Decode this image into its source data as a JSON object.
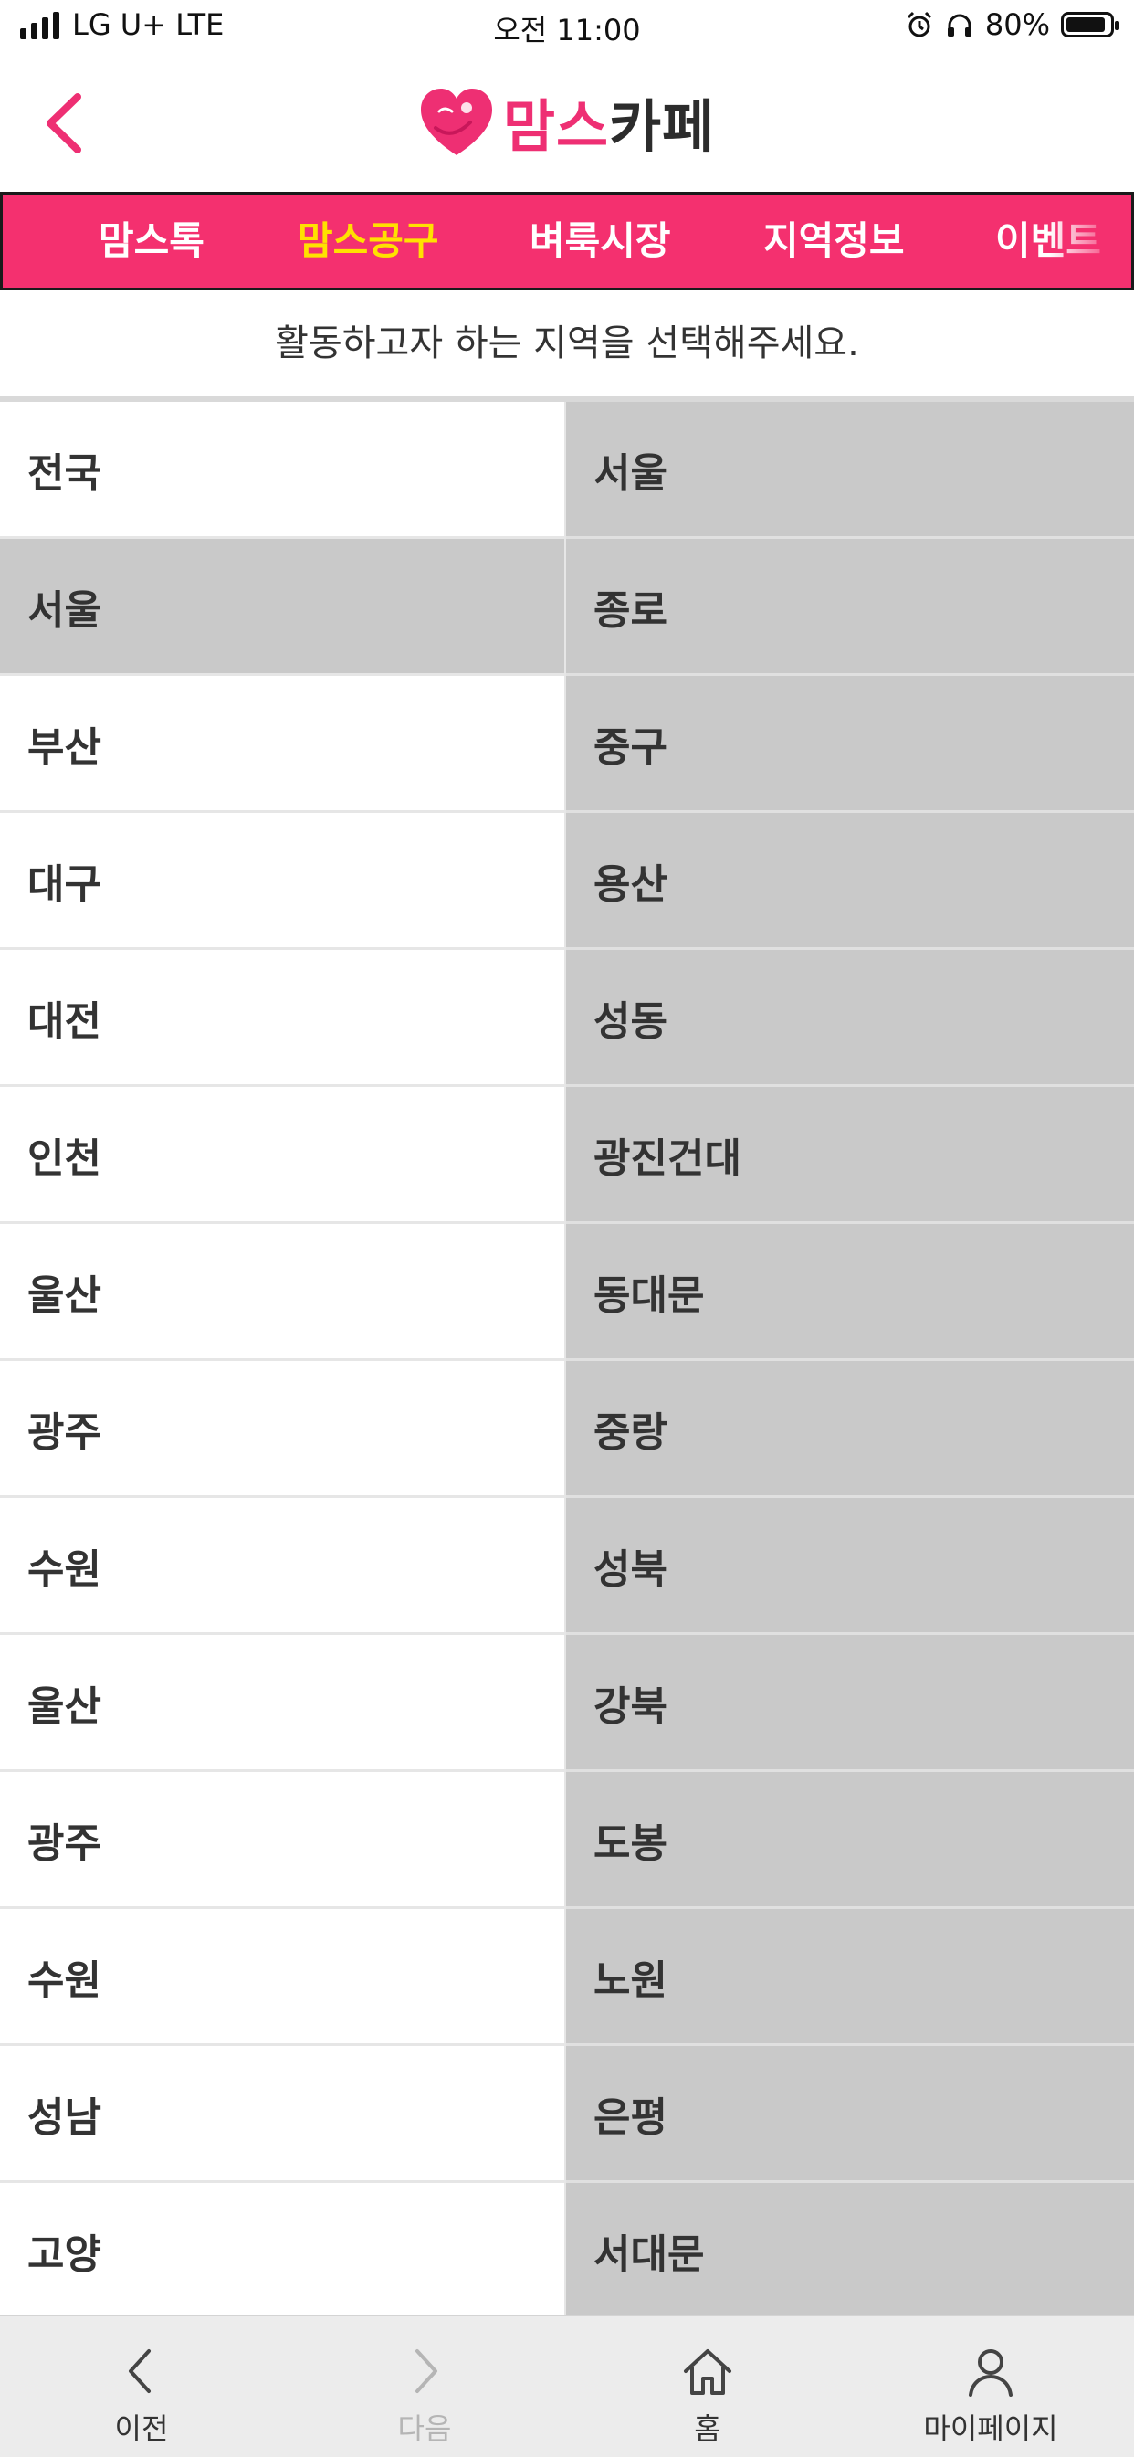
{
  "status_bar": {
    "carrier": "LG U+ LTE",
    "time": "오전 11:00",
    "battery_percent": "80%"
  },
  "header": {
    "logo_text_pink": "맘스",
    "logo_text_dark": "카페",
    "accent_color": "#ee2f73"
  },
  "nav": {
    "items": [
      {
        "label": "맘스톡"
      },
      {
        "label": "맘스공구"
      },
      {
        "label": "벼룩시장"
      },
      {
        "label": "지역정보"
      },
      {
        "label": "이벤트"
      }
    ],
    "active_index": 1,
    "bg_color": "#f4306f",
    "active_color": "#ffe100"
  },
  "instruction": "활동하고자 하는 지역을 선택해주세요.",
  "regions_left": [
    "전국",
    "서울",
    "부산",
    "대구",
    "대전",
    "인천",
    "울산",
    "광주",
    "수원",
    "울산",
    "광주",
    "수원",
    "성남",
    "고양"
  ],
  "selected_left_index": 1,
  "regions_right": [
    "서울",
    "종로",
    "중구",
    "용산",
    "성동",
    "광진건대",
    "동대문",
    "중랑",
    "성북",
    "강북",
    "도봉",
    "노원",
    "은평",
    "서대문"
  ],
  "bottom_bar": {
    "prev": "이전",
    "next": "다음",
    "home": "홈",
    "mypage": "마이페이지"
  }
}
